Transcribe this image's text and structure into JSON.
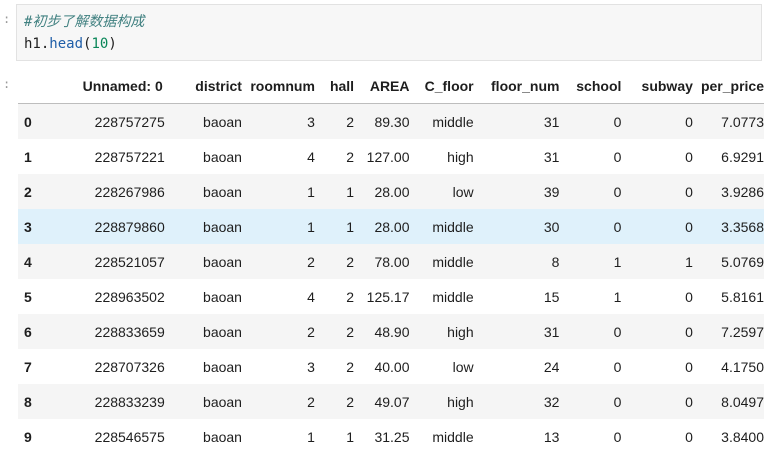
{
  "prompts": {
    "input": ":",
    "output": ":"
  },
  "code": {
    "comment": "#初步了解数据构成",
    "object": "h1",
    "dot": ".",
    "method": "head",
    "open_paren": "(",
    "argument": "10",
    "close_paren": ")"
  },
  "table": {
    "columns": [
      "Unnamed: 0",
      "district",
      "roomnum",
      "hall",
      "AREA",
      "C_floor",
      "floor_num",
      "school",
      "subway",
      "per_price"
    ],
    "rows": [
      {
        "index": "0",
        "cells": [
          "228757275",
          "baoan",
          "3",
          "2",
          "89.30",
          "middle",
          "31",
          "0",
          "0",
          "7.0773"
        ]
      },
      {
        "index": "1",
        "cells": [
          "228757221",
          "baoan",
          "4",
          "2",
          "127.00",
          "high",
          "31",
          "0",
          "0",
          "6.9291"
        ]
      },
      {
        "index": "2",
        "cells": [
          "228267986",
          "baoan",
          "1",
          "1",
          "28.00",
          "low",
          "39",
          "0",
          "0",
          "3.9286"
        ]
      },
      {
        "index": "3",
        "cells": [
          "228879860",
          "baoan",
          "1",
          "1",
          "28.00",
          "middle",
          "30",
          "0",
          "0",
          "3.3568"
        ]
      },
      {
        "index": "4",
        "cells": [
          "228521057",
          "baoan",
          "2",
          "2",
          "78.00",
          "middle",
          "8",
          "1",
          "1",
          "5.0769"
        ]
      },
      {
        "index": "5",
        "cells": [
          "228963502",
          "baoan",
          "4",
          "2",
          "125.17",
          "middle",
          "15",
          "1",
          "0",
          "5.8161"
        ]
      },
      {
        "index": "6",
        "cells": [
          "228833659",
          "baoan",
          "2",
          "2",
          "48.90",
          "high",
          "31",
          "0",
          "0",
          "7.2597"
        ]
      },
      {
        "index": "7",
        "cells": [
          "228707326",
          "baoan",
          "3",
          "2",
          "40.00",
          "low",
          "24",
          "0",
          "0",
          "4.1750"
        ]
      },
      {
        "index": "8",
        "cells": [
          "228833239",
          "baoan",
          "2",
          "2",
          "49.07",
          "high",
          "32",
          "0",
          "0",
          "8.0497"
        ]
      },
      {
        "index": "9",
        "cells": [
          "228546575",
          "baoan",
          "1",
          "1",
          "31.25",
          "middle",
          "13",
          "0",
          "0",
          "3.8400"
        ]
      }
    ],
    "hovered_row_index": "3"
  },
  "colors": {
    "comment": "#408080",
    "method": "#1f5ea8",
    "number": "#098658",
    "hover_row": "#dff1fb",
    "stripe_row": "#f5f5f5"
  }
}
